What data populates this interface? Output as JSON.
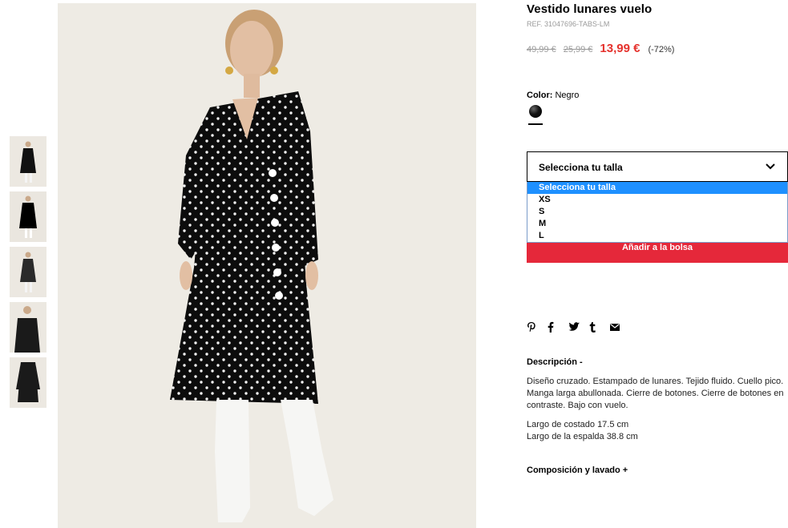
{
  "product": {
    "title": "Vestido lunares vuelo",
    "ref": "REF. 31047696-TABS-LM",
    "old_price_1": "49,99 €",
    "old_price_2": "25,99 €",
    "price": "13,99 €",
    "discount": "(-72%)"
  },
  "color": {
    "label": "Color:",
    "value": "Negro",
    "swatch_hex": "#000000"
  },
  "size_select": {
    "selected": "Selecciona tu talla",
    "options": [
      "Selecciona tu talla",
      "XS",
      "S",
      "M",
      "L"
    ]
  },
  "add_button": "Añadir a la bolsa",
  "share_icons": [
    "pinterest-icon",
    "facebook-icon",
    "twitter-icon",
    "tumblr-icon",
    "email-icon"
  ],
  "description": {
    "title": "Descripción -",
    "text": "Diseño cruzado. Estampado de lunares. Tejido fluido. Cuello pico. Manga larga abullonada. Cierre de botones. Cierre de botones en contraste. Bajo con vuelo.",
    "measure_1": "Largo de costado 17.5 cm",
    "measure_2": "Largo de la espalda 38.8 cm"
  },
  "composition_title": "Composición y lavado +",
  "colors": {
    "accent_red": "#e5283a",
    "price_red": "#e5322d",
    "dropdown_highlight": "#1e90ff"
  }
}
